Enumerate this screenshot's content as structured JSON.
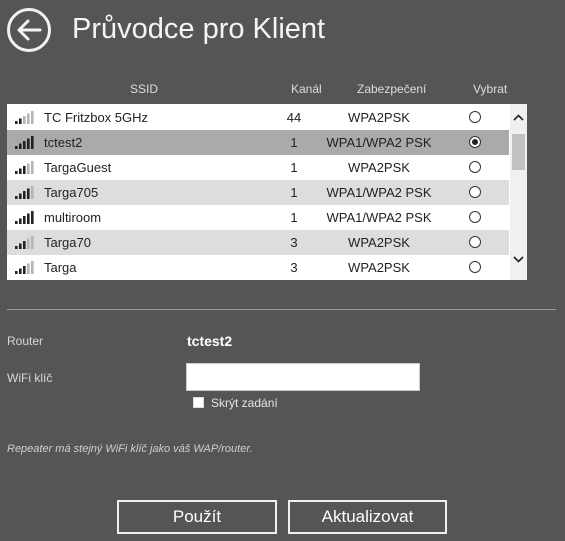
{
  "header": {
    "title": "Průvodce pro Klient"
  },
  "table": {
    "columns": {
      "ssid": "SSID",
      "channel": "Kanál",
      "security": "Zabezpečení",
      "select": "Vybrat"
    },
    "rows": [
      {
        "ssid": "TC Fritzbox 5GHz",
        "channel": "44",
        "security": "WPA2PSK",
        "signal": 2,
        "selected": false
      },
      {
        "ssid": "tctest2",
        "channel": "1",
        "security": "WPA1/WPA2 PSK",
        "signal": 5,
        "selected": true
      },
      {
        "ssid": "TargaGuest",
        "channel": "1",
        "security": "WPA2PSK",
        "signal": 3,
        "selected": false
      },
      {
        "ssid": "Targa705",
        "channel": "1",
        "security": "WPA1/WPA2 PSK",
        "signal": 4,
        "selected": false
      },
      {
        "ssid": "multiroom",
        "channel": "1",
        "security": "WPA1/WPA2 PSK",
        "signal": 5,
        "selected": false
      },
      {
        "ssid": "Targa70",
        "channel": "3",
        "security": "WPA2PSK",
        "signal": 3,
        "selected": false
      },
      {
        "ssid": "Targa",
        "channel": "3",
        "security": "WPA2PSK",
        "signal": 3,
        "selected": false
      }
    ]
  },
  "form": {
    "router_label": "Router",
    "router_value": "tctest2",
    "key_label": "WiFi klíč",
    "key_value": "",
    "hide_label": "Skrýt zadání",
    "hide_checked": false
  },
  "note": "Repeater má stejný WiFi klíč jako váš WAP/router.",
  "buttons": {
    "apply": "Použít",
    "refresh": "Aktualizovat"
  }
}
